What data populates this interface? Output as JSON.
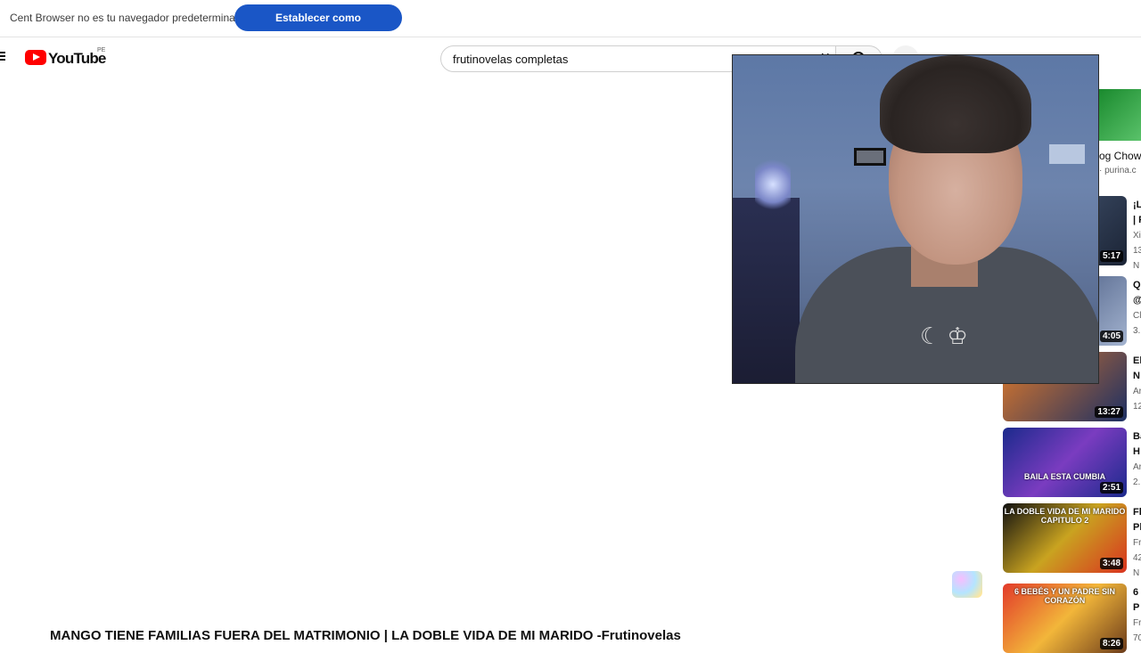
{
  "browser_infobar": {
    "message": "Cent Browser no es tu navegador predeterminado",
    "button_label": "Establecer como predeterminado"
  },
  "header": {
    "logo_text": "YouTube",
    "country_code": "PE",
    "search": {
      "value": "frutinovelas completas",
      "clear_icon": "close-icon"
    }
  },
  "sidebar": {
    "ad": {
      "title": "og Chow",
      "subtitle": "· purina.c"
    },
    "related_videos": [
      {
        "duration": "5:17",
        "title": "¡L",
        "title2": "| F",
        "channel": "Xi",
        "meta": "13",
        "badge": "N"
      },
      {
        "duration": "4:05",
        "title": "Q",
        "title2": "@",
        "channel": "Cl",
        "meta": "3."
      },
      {
        "duration": "13:27",
        "title": "El",
        "title2": "N",
        "channel": "Ar",
        "meta": "12"
      },
      {
        "duration": "2:51",
        "title": "Ba",
        "title2": "H",
        "channel": "Ar",
        "meta": "2.",
        "thumb_caption": "BAILA ESTA CUMBIA"
      },
      {
        "duration": "3:48",
        "title": "Fl",
        "title2": "Pl",
        "channel": "Fr",
        "meta": "42",
        "badge": "N",
        "thumb_caption": "LA DOBLE VIDA DE MI MARIDO CAPITULO 2"
      },
      {
        "duration": "8:26",
        "title": "6",
        "title2": "P",
        "channel": "Fr",
        "meta": "70",
        "thumb_caption": "6 BEBÉS Y UN PADRE SIN CORAZÓN"
      }
    ]
  },
  "main": {
    "video_title": "MANGO TIENE FAMILIAS FUERA DEL MATRIMONIO | LA DOBLE VIDA DE MI MARIDO -Frutinovelas"
  },
  "colors": {
    "primary_button": "#1a56c6",
    "youtube_red": "#ff0000"
  }
}
